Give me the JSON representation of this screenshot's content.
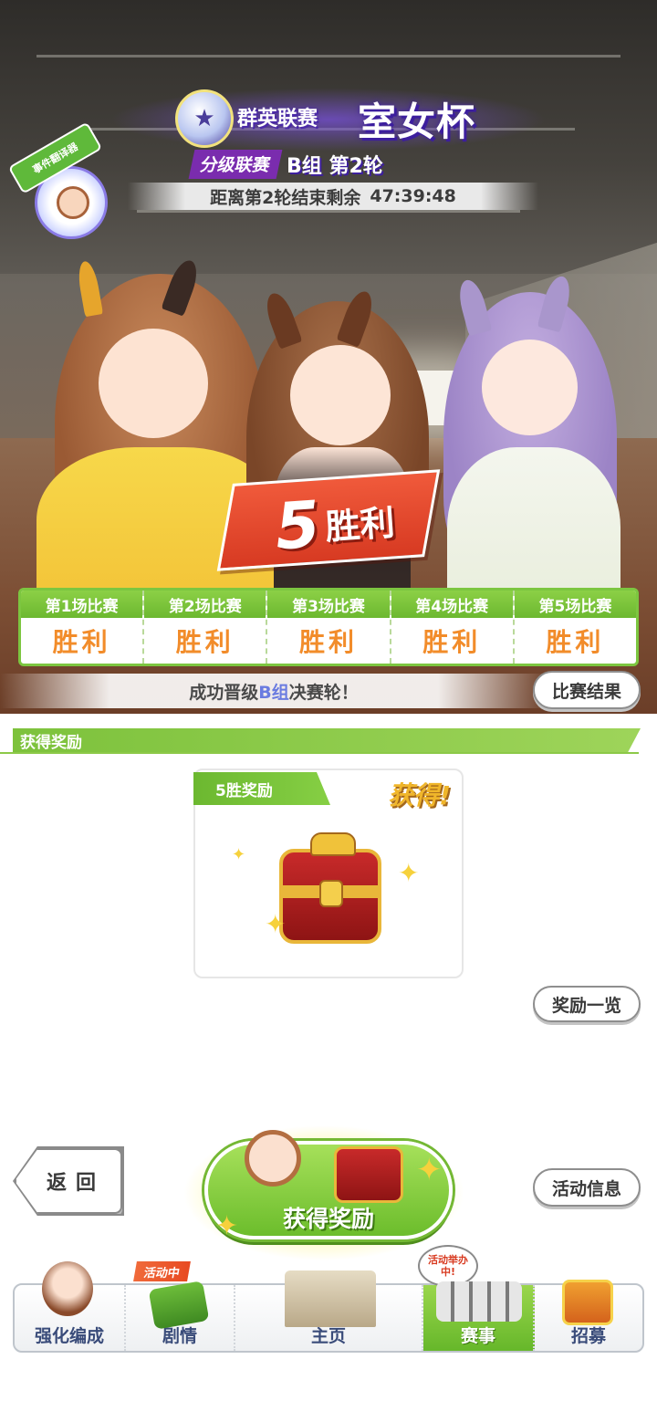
{
  "event": {
    "title_left": "群英联赛",
    "title_right": "室女杯",
    "league_tag": "分级联赛",
    "group_round": "B组 第2轮",
    "countdown_label": "距离第2轮结束剩余",
    "countdown_time": "47:39:48",
    "badge_label": "事件翻译器"
  },
  "result": {
    "wins_number": "5",
    "wins_word": "胜利",
    "matches": [
      {
        "label": "第1场比赛",
        "result": "胜利"
      },
      {
        "label": "第2场比赛",
        "result": "胜利"
      },
      {
        "label": "第3场比赛",
        "result": "胜利"
      },
      {
        "label": "第4场比赛",
        "result": "胜利"
      },
      {
        "label": "第5场比赛",
        "result": "胜利"
      }
    ],
    "promotion_prefix": "成功晋级",
    "promotion_group": "B组",
    "promotion_suffix": "决赛轮！",
    "results_button": "比赛结果"
  },
  "reward": {
    "section_title": "获得奖励",
    "card_tag": "5胜奖励",
    "obtained": "获得!",
    "list_button": "奖励一览"
  },
  "controls": {
    "back": "返回",
    "claim": "获得奖励",
    "event_info": "活动信息"
  },
  "nav": {
    "items": [
      {
        "label": "强化编成",
        "icon": "character-icon"
      },
      {
        "label": "剧情",
        "icon": "book-icon",
        "badge": "活动中"
      },
      {
        "label": "主页",
        "icon": "building-icon"
      },
      {
        "label": "赛事",
        "icon": "race-gate-icon",
        "bubble": "活动举办中!"
      },
      {
        "label": "招募",
        "icon": "gacha-card-icon"
      }
    ],
    "active_index": 3
  },
  "colors": {
    "accent_green": "#7cc640",
    "win_orange": "#f28c2a",
    "banner_red": "#e0452c",
    "title_purple": "#4b2aa8"
  }
}
